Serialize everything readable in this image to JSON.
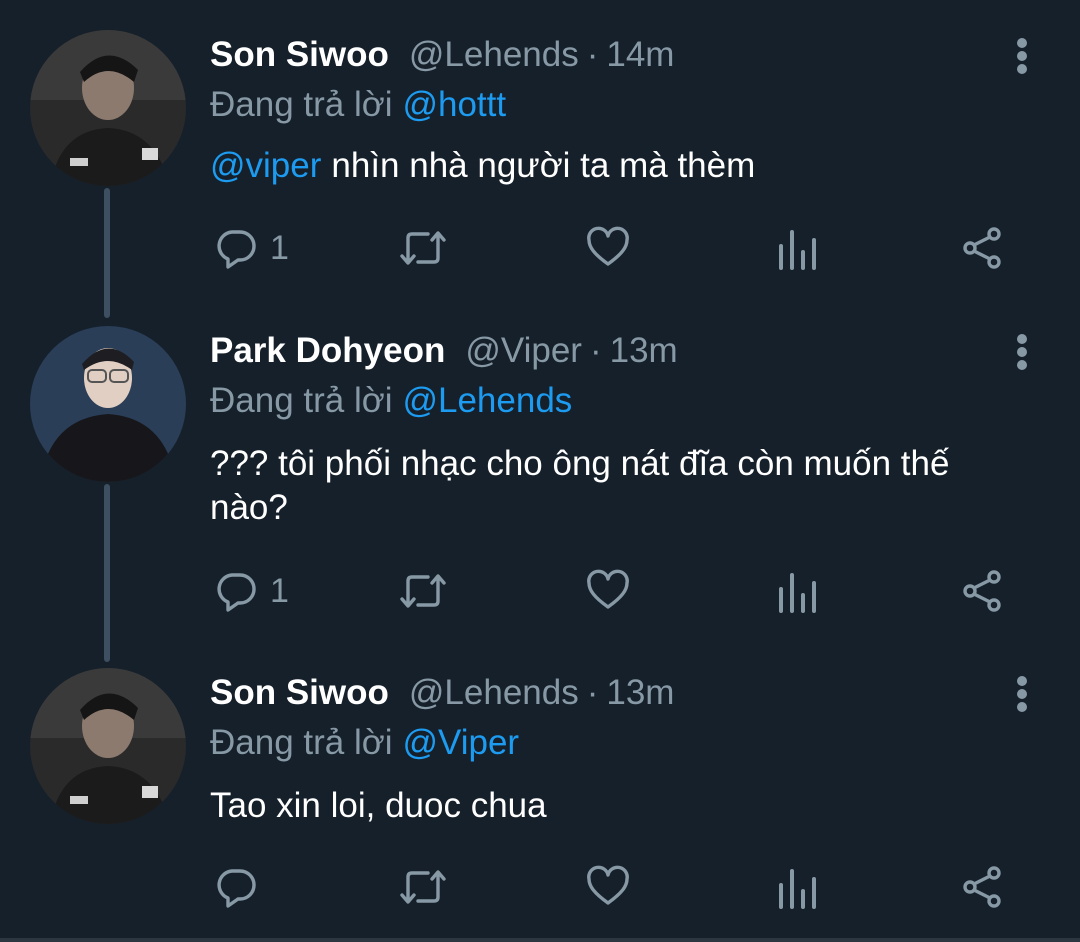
{
  "colors": {
    "background": "#15202b",
    "secondary_text": "#8899a6",
    "mention": "#1d9bf0",
    "thread_line": "#3d4f60"
  },
  "tweets": [
    {
      "name": "Son Siwoo",
      "handle": "@Lehends",
      "separator": "·",
      "time": "14m",
      "reply_prefix": "Đang trả lời",
      "reply_to": "@hottt",
      "body_mention": "@viper",
      "body_text": "nhìn nhà người ta mà thèm",
      "reply_count": "1",
      "avatar": "avatar-son-siwoo"
    },
    {
      "name": "Park Dohyeon",
      "handle": "@Viper",
      "separator": "·",
      "time": "13m",
      "reply_prefix": "Đang trả lời",
      "reply_to": "@Lehends",
      "body_mention": "",
      "body_text": "??? tôi phối nhạc cho ông nát đĩa còn muốn thế nào?",
      "reply_count": "1",
      "avatar": "avatar-park-dohyeon"
    },
    {
      "name": "Son Siwoo",
      "handle": "@Lehends",
      "separator": "·",
      "time": "13m",
      "reply_prefix": "Đang trả lời",
      "reply_to": "@Viper",
      "body_mention": "",
      "body_text": "Tao xin loi, duoc chua",
      "reply_count": "",
      "avatar": "avatar-son-siwoo"
    }
  ],
  "icons": [
    "reply-icon",
    "retweet-icon",
    "like-icon",
    "analytics-icon",
    "share-icon",
    "more-options-icon"
  ]
}
